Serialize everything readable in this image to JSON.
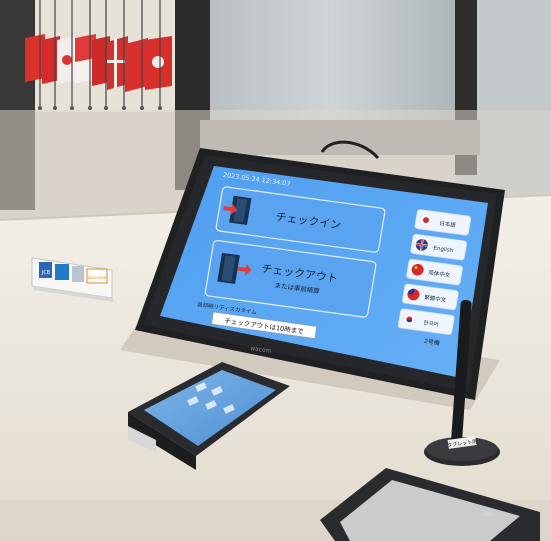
{
  "colors": {
    "wall": "#d9d3c9",
    "counter": "#efe9df",
    "screen_blue": "#5aa6f2",
    "bezel": "#202124",
    "card_blue": "#6aa8ee"
  },
  "kiosk": {
    "timestamp": "2023.05.24 12:34:07",
    "buttons": {
      "checkin_label": "チェックイン",
      "checkout_label": "チェックアウト",
      "checkout_sublabel": "または事前精算"
    },
    "language_options": [
      "日本語",
      "English",
      "简体中文",
      "繁體中文",
      "한국어"
    ],
    "footer_left": "返却時リディスカタイム",
    "footer_right_number": "2号機",
    "brand": "wacom",
    "sticker": "チェックアウトは10時まで"
  },
  "counter": {
    "card_sign_brands": [
      "JCB",
      "AMERICAN EXPRESS",
      "DISCOVER"
    ],
    "pen_stand_label": "タブレット用"
  },
  "icons": {
    "checkin": "door-enter-icon",
    "checkout": "door-exit-icon",
    "flags": [
      "japan-flag-icon",
      "uk-flag-icon",
      "china-flag-icon",
      "taiwan-flag-icon",
      "korea-flag-icon"
    ]
  }
}
